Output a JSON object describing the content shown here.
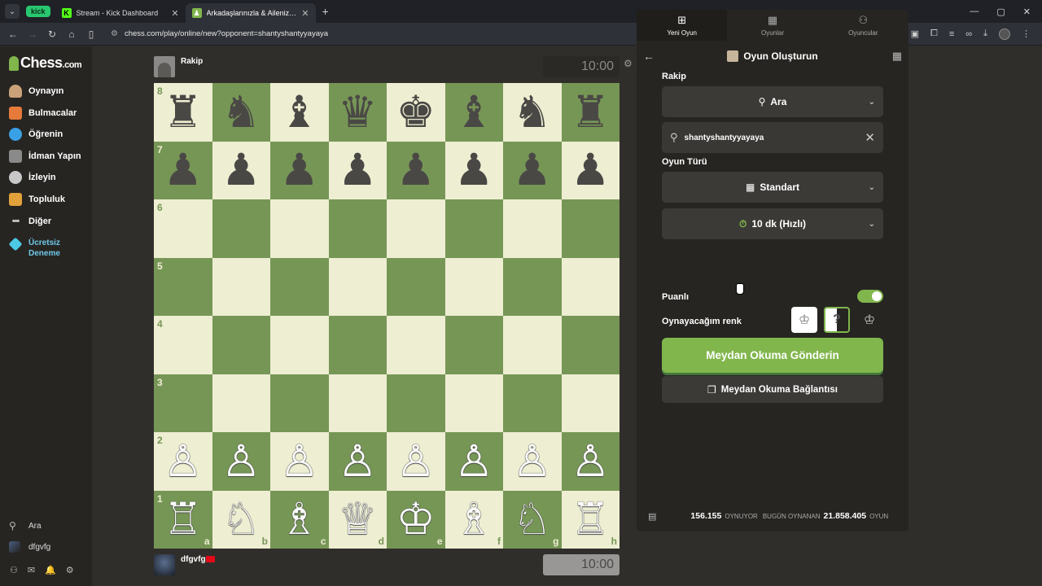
{
  "browser": {
    "group_label": "kick",
    "tabs": [
      {
        "title": "Stream - Kick Dashboard",
        "favicon": "K",
        "active": false
      },
      {
        "title": "Arkadaşlarınızla & Ailenizle Üc...",
        "favicon": "♟",
        "active": true
      }
    ],
    "url": "chess.com/play/online/new?opponent=shantyshantyyayaya"
  },
  "sidebar": {
    "logo_text": "Chess",
    "logo_suffix": ".com",
    "items": [
      {
        "label": "Oynayın",
        "icon": "play-icon"
      },
      {
        "label": "Bulmacalar",
        "icon": "puzzle-icon"
      },
      {
        "label": "Öğrenin",
        "icon": "learn-icon"
      },
      {
        "label": "İdman Yapın",
        "icon": "train-icon"
      },
      {
        "label": "İzleyin",
        "icon": "binoculars-icon"
      },
      {
        "label": "Topluluk",
        "icon": "community-icon"
      },
      {
        "label": "Diğer",
        "icon": "more-icon"
      }
    ],
    "free_trial_line1": "Ücretsiz",
    "free_trial_line2": "Deneme",
    "search_label": "Ara",
    "username": "dfgvfg"
  },
  "game": {
    "opponent_name": "Rakip",
    "opponent_clock": "10:00",
    "player_name": "dfgvfg",
    "player_clock": "10:00",
    "ranks": [
      "8",
      "7",
      "6",
      "5",
      "4",
      "3",
      "2",
      "1"
    ],
    "files": [
      "a",
      "b",
      "c",
      "d",
      "e",
      "f",
      "g",
      "h"
    ],
    "board": [
      [
        "♜",
        "♞",
        "♝",
        "♛",
        "♚",
        "♝",
        "♞",
        "♜"
      ],
      [
        "♟",
        "♟",
        "♟",
        "♟",
        "♟",
        "♟",
        "♟",
        "♟"
      ],
      [
        "",
        "",
        "",
        "",
        "",
        "",
        "",
        ""
      ],
      [
        "",
        "",
        "",
        "",
        "",
        "",
        "",
        ""
      ],
      [
        "",
        "",
        "",
        "",
        "",
        "",
        "",
        ""
      ],
      [
        "",
        "",
        "",
        "",
        "",
        "",
        "",
        ""
      ],
      [
        "♙",
        "♙",
        "♙",
        "♙",
        "♙",
        "♙",
        "♙",
        "♙"
      ],
      [
        "♖",
        "♘",
        "♗",
        "♕",
        "♔",
        "♗",
        "♘",
        "♖"
      ]
    ]
  },
  "panel": {
    "tabs": [
      {
        "label": "Yeni Oyun",
        "active": true
      },
      {
        "label": "Oyunlar",
        "active": false
      },
      {
        "label": "Oyuncular",
        "active": false
      }
    ],
    "title": "Oyun Oluşturun",
    "opponent_label": "Rakip",
    "opponent_select": "Ara",
    "opponent_search_value": "shantyshantyyayaya",
    "game_type_label": "Oyun Türü",
    "game_type_value": "Standart",
    "time_control_value": "10 dk (Hızlı)",
    "rated_label": "Puanlı",
    "rated_on": true,
    "color_label": "Oynayacağım renk",
    "color_random_glyph": "?",
    "send_button": "Meydan Okuma Gönderin",
    "link_button": "Meydan Okuma Bağlantısı",
    "stats": {
      "playing_count": "156.155",
      "playing_label": "OYNUYOR",
      "today_label": "BUGÜN OYNANAN",
      "today_count": "21.858.405",
      "games_label": "OYUN"
    }
  },
  "colors": {
    "board_light": "#eeeed2",
    "board_dark": "#769656",
    "accent_green": "#81b64c"
  }
}
